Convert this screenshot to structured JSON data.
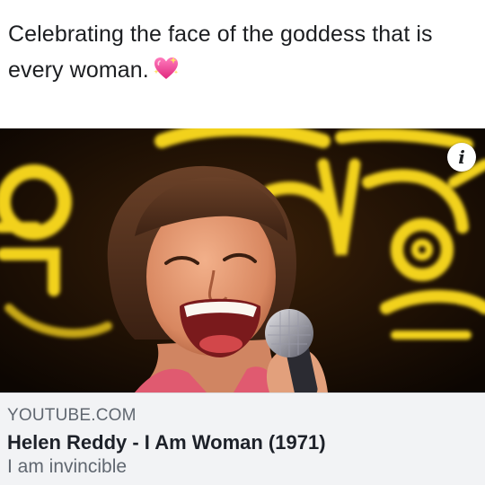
{
  "post": {
    "text_line1": "Celebrating the face of the goddess that is",
    "text_line2": "every woman.",
    "emoji": "sparkling-heart"
  },
  "preview": {
    "thumbnail": "singer-with-microphone-neon-background",
    "info_label": "i"
  },
  "link": {
    "domain": "YOUTUBE.COM",
    "title": "Helen Reddy - I Am Woman (1971)",
    "description": "I am invincible"
  },
  "colors": {
    "neon_yellow": "#f2d21a",
    "background_dark": "#120a04",
    "link_box_bg": "#f2f3f5",
    "heart_pink": "#f0529c"
  }
}
